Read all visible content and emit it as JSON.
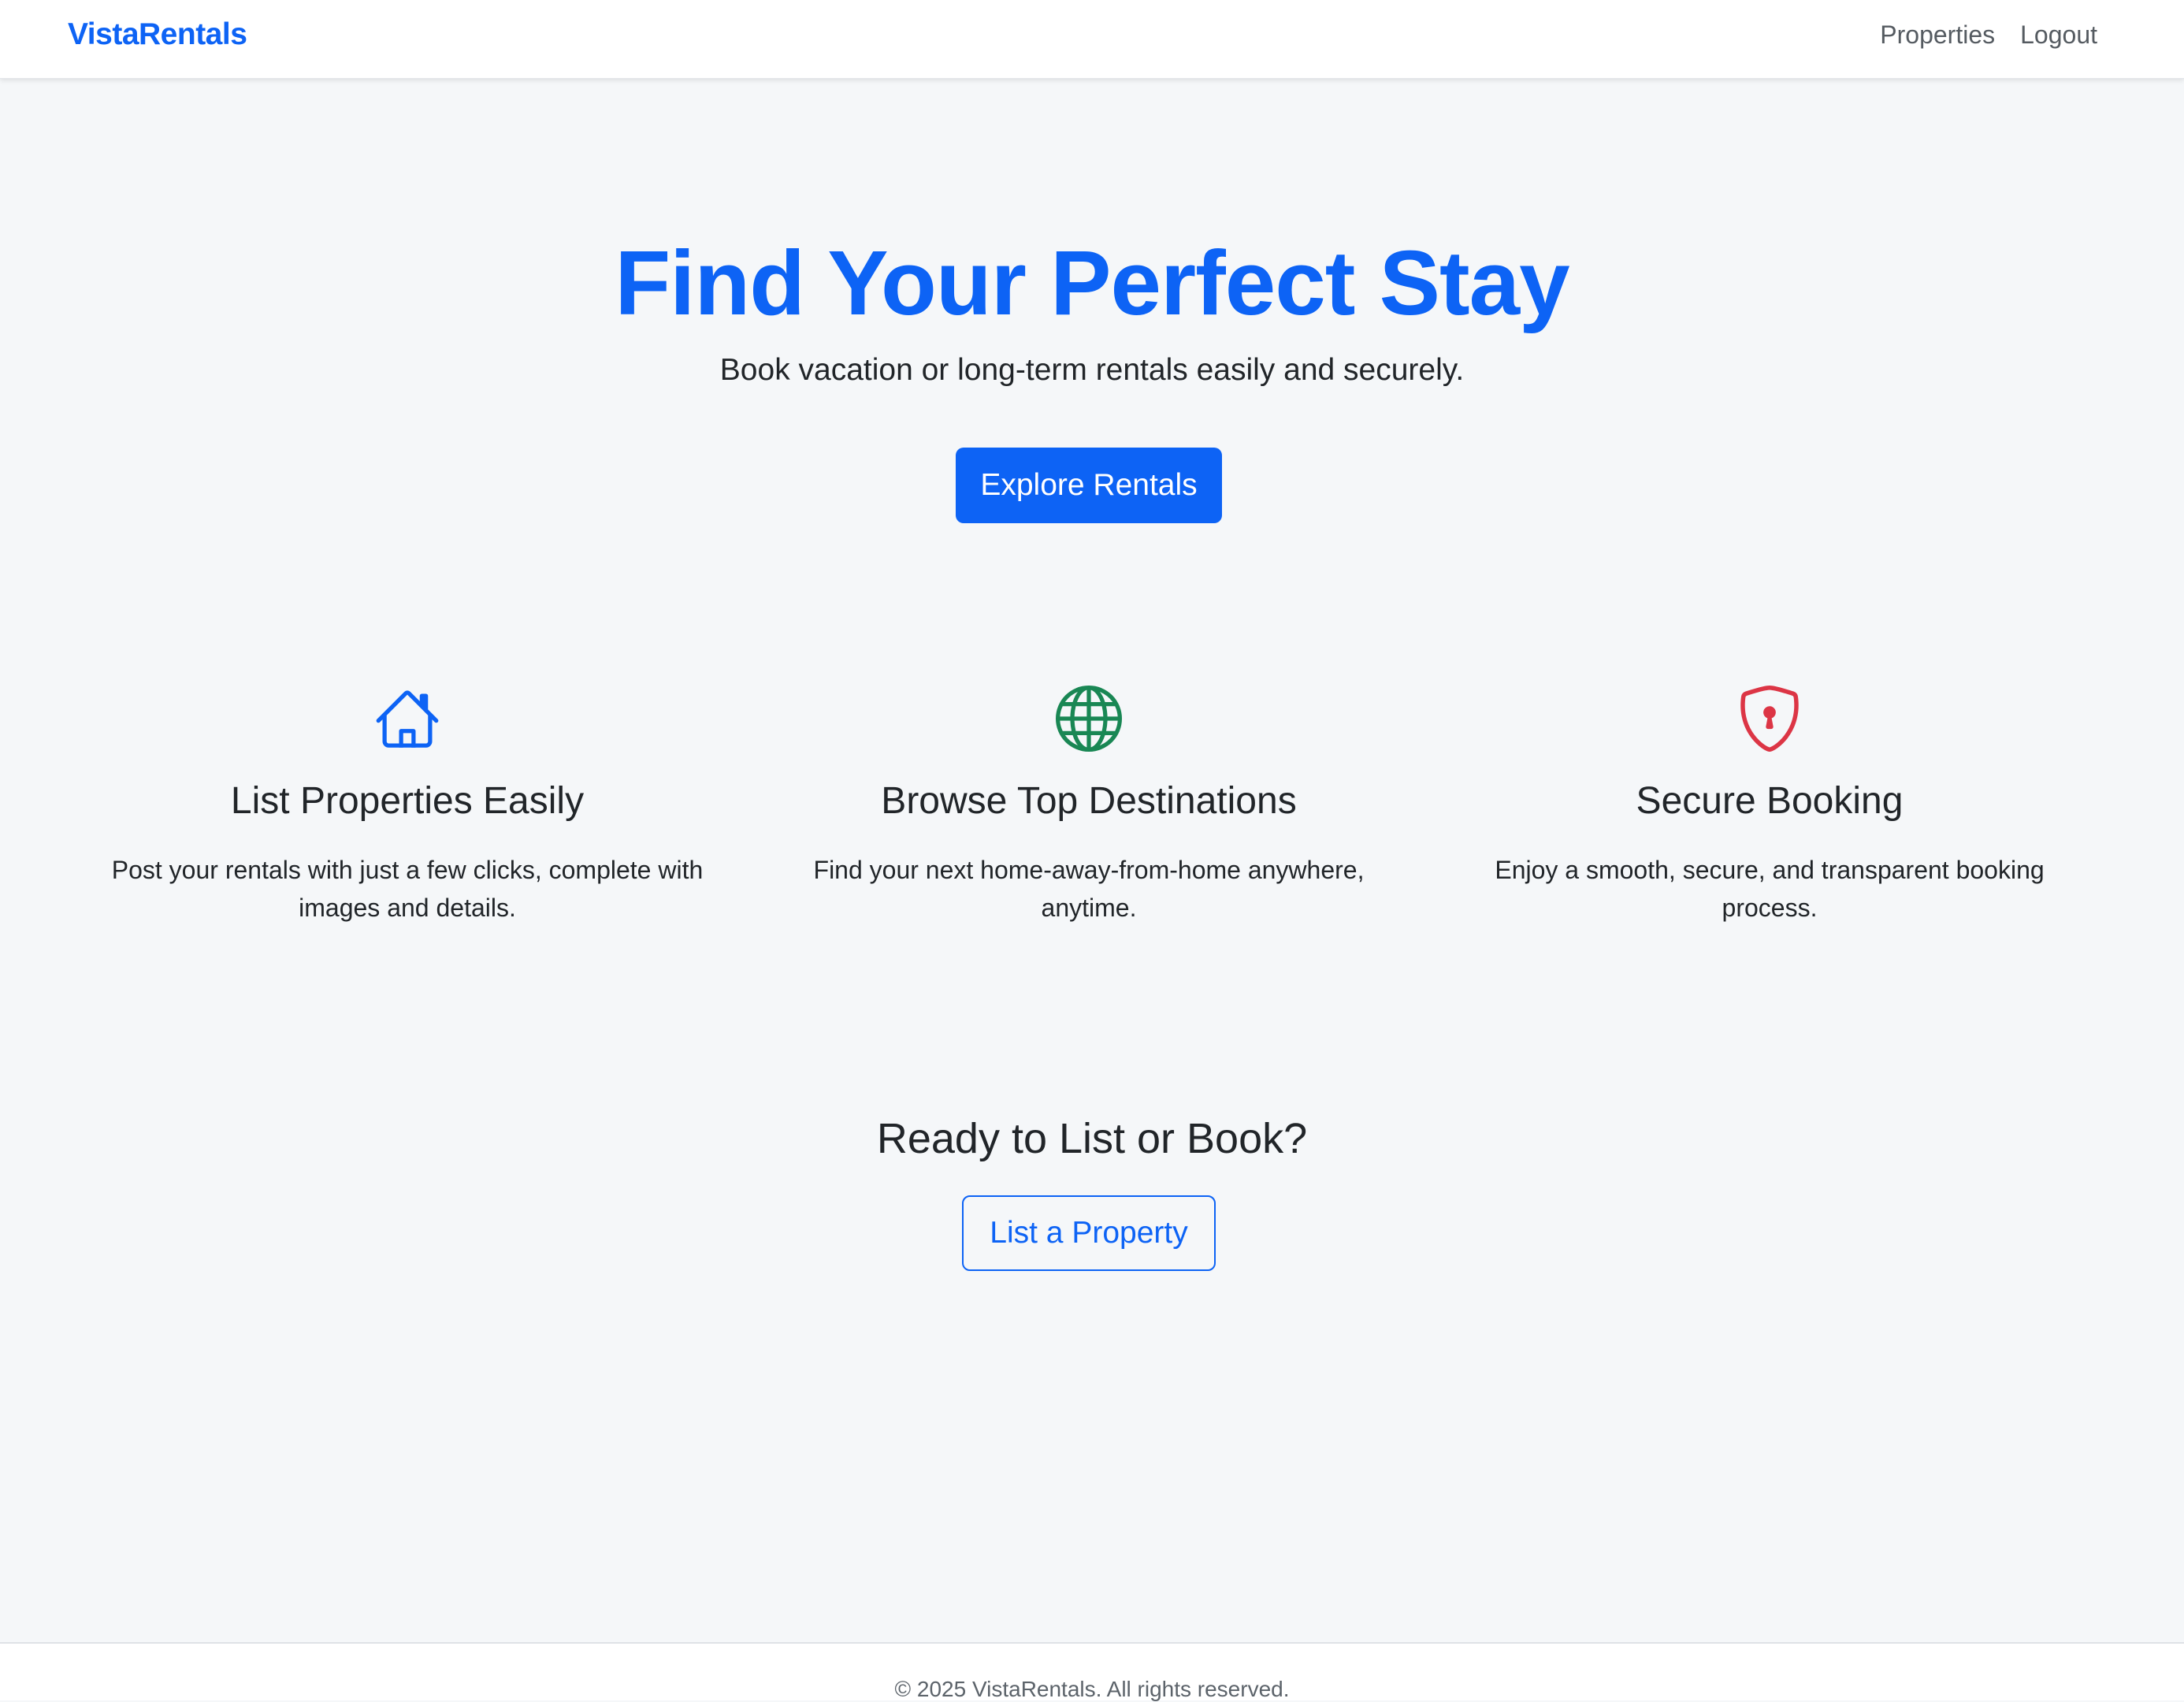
{
  "navbar": {
    "brand": "VistaRentals",
    "links": [
      "Properties",
      "Logout"
    ]
  },
  "hero": {
    "title": "Find Your Perfect Stay",
    "subtitle": "Book vacation or long-term rentals easily and securely.",
    "cta_label": "Explore Rentals"
  },
  "features": [
    {
      "icon": "house-icon",
      "icon_color": "#0d63f5",
      "title": "List Properties Easily",
      "text": "Post your rentals with just a few clicks, complete with images and details."
    },
    {
      "icon": "globe-icon",
      "icon_color": "#198754",
      "title": "Browse Top Destinations",
      "text": "Find your next home-away-from-home anywhere, anytime."
    },
    {
      "icon": "shield-lock-icon",
      "icon_color": "#dc3545",
      "title": "Secure Booking",
      "text": "Enjoy a smooth, secure, and transparent booking process."
    }
  ],
  "cta": {
    "title": "Ready to List or Book?",
    "button_label": "List a Property"
  },
  "footer": {
    "text": "© 2025 VistaRentals. All rights reserved."
  },
  "colors": {
    "primary": "#0d63f5",
    "background": "#f5f7f9"
  }
}
